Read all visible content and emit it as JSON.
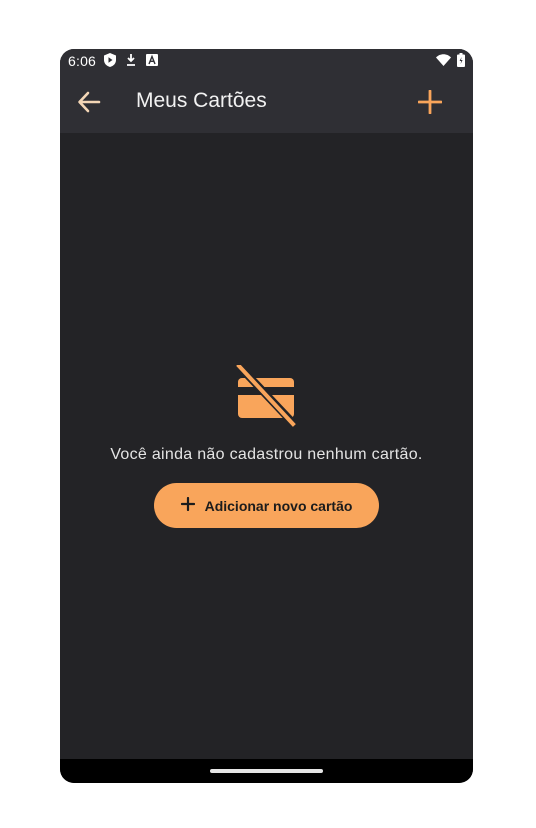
{
  "status_bar": {
    "time": "6:06",
    "left_icons": [
      "play-protect-icon",
      "download-icon",
      "font-a-icon"
    ],
    "right_icons": [
      "wifi-icon",
      "battery-icon"
    ]
  },
  "app_bar": {
    "title": "Meus Cartões",
    "back_icon": "arrow-left-icon",
    "add_icon": "plus-icon"
  },
  "empty_state": {
    "icon": "credit-card-off-icon",
    "message": "Você ainda não cadastrou nenhum cartão.",
    "button_label": "Adicionar novo cartão",
    "button_icon": "plus-icon"
  },
  "colors": {
    "accent": "#f9a55b",
    "background": "#232326",
    "app_bar": "#2f2f34"
  }
}
